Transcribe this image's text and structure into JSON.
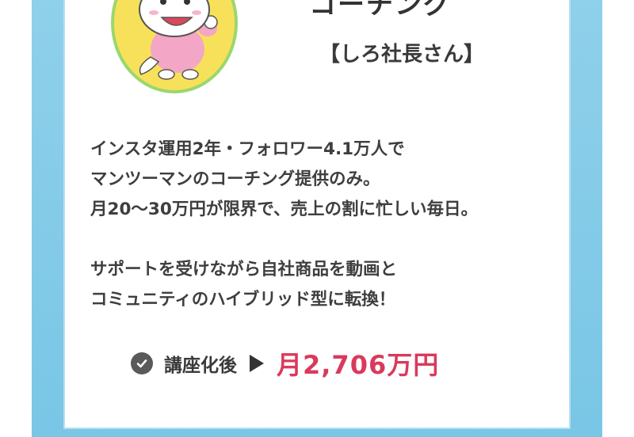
{
  "header": {
    "title_partial": "コーチング",
    "subtitle": "【しろ社長さん】"
  },
  "mascot": {
    "icon": "mascot-illustration",
    "circle_color": "#f8e15a",
    "ring_color": "#9bd76d"
  },
  "body": {
    "paragraph1": [
      "インスタ運用2年・フォロワー4.1万人で",
      "マンツーマンのコーチング提供のみ。",
      "月20〜30万円が限界で、売上の割に忙しい毎日。"
    ],
    "paragraph2": [
      "サポートを受けながら自社商品を動画と",
      "コミュニティのハイブリッド型に転換！"
    ]
  },
  "result": {
    "label": "講座化後",
    "value": "月2,706万円",
    "value_color": "#d93a5c"
  },
  "colors": {
    "frame": "#79c6e6",
    "card_border": "#b7e0f0"
  }
}
